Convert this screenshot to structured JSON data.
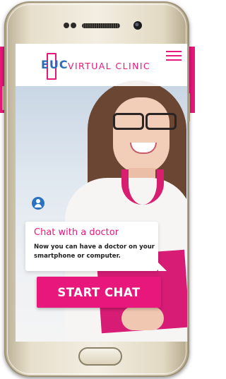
{
  "header": {
    "logo_mark": "EUC",
    "logo_text": "VIRTUAL CLINIC"
  },
  "chat_card": {
    "title": "Chat with a doctor",
    "subtitle": "Now you can have a doctor on your smartphone or computer."
  },
  "cta": {
    "label": "START CHAT"
  },
  "icons": {
    "menu": "hamburger-menu-icon",
    "user": "user-icon"
  },
  "colors": {
    "brand_pink": "#e8177b",
    "brand_blue": "#2a6fb5",
    "device_gold": "#e7dfcb"
  }
}
